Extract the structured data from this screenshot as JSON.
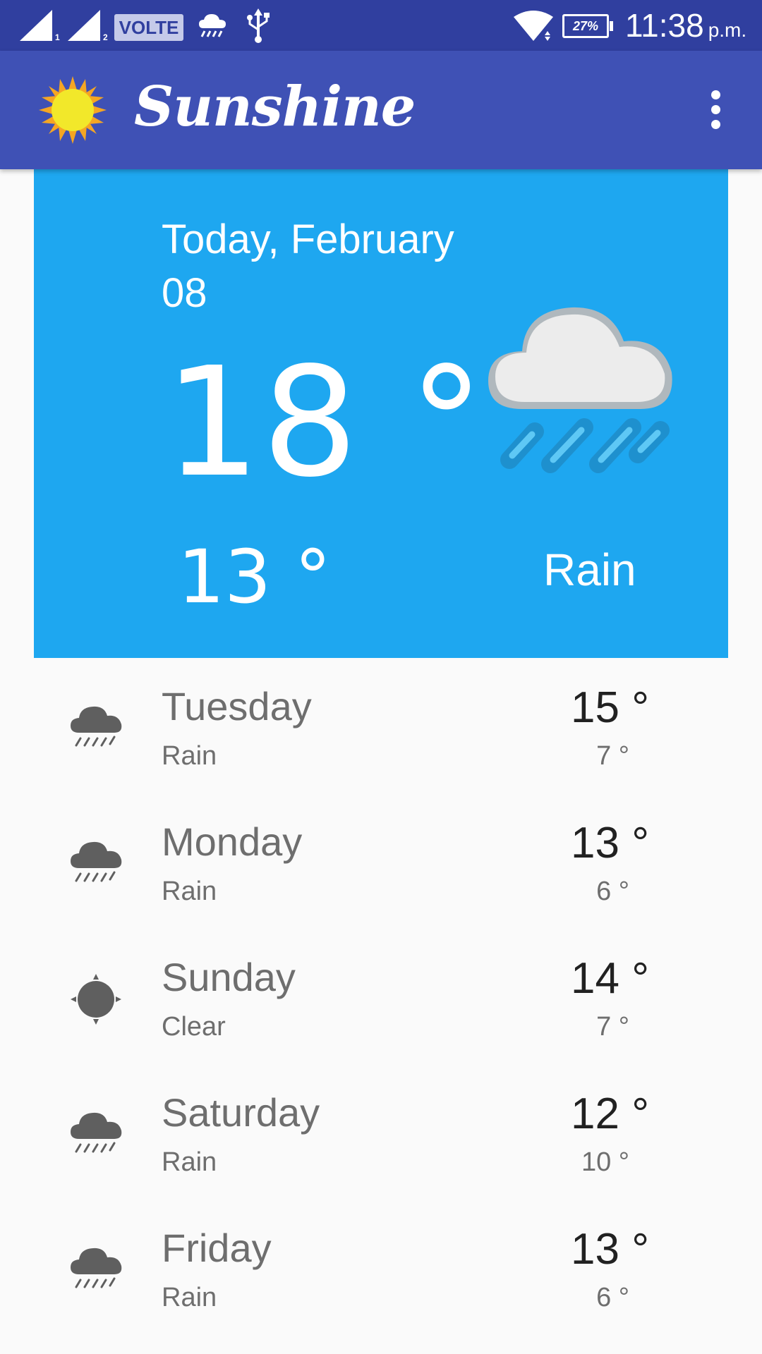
{
  "status_bar": {
    "sim1_label": "1",
    "sim2_label": "2",
    "volte_label": "VOLTE",
    "battery_label": "27%",
    "time": "11:38",
    "ampm": "p.m."
  },
  "app_bar": {
    "title": "Sunshine",
    "logo_icon": "sun-icon",
    "menu_icon": "more-vert-icon"
  },
  "today": {
    "date_line1": "Today, February",
    "date_line2": "08",
    "high": "18 °",
    "low": "13 °",
    "description": "Rain",
    "icon": "rain-cloud-art"
  },
  "forecast": [
    {
      "day": "Tuesday",
      "description": "Rain",
      "high": "15 °",
      "low": "7 °",
      "icon": "rain-icon"
    },
    {
      "day": "Monday",
      "description": "Rain",
      "high": "13 °",
      "low": "6 °",
      "icon": "rain-icon"
    },
    {
      "day": "Sunday",
      "description": "Clear",
      "high": "14 °",
      "low": "7 °",
      "icon": "sun-icon"
    },
    {
      "day": "Saturday",
      "description": "Rain",
      "high": "12 °",
      "low": "10 °",
      "icon": "rain-icon"
    },
    {
      "day": "Friday",
      "description": "Rain",
      "high": "13 °",
      "low": "6 °",
      "icon": "rain-icon"
    }
  ],
  "colors": {
    "status_bar": "#303f9f",
    "app_bar": "#3f51b5",
    "today_card": "#1ea7f0",
    "background": "#fafafa",
    "icon_gray": "#5f5f5f"
  }
}
